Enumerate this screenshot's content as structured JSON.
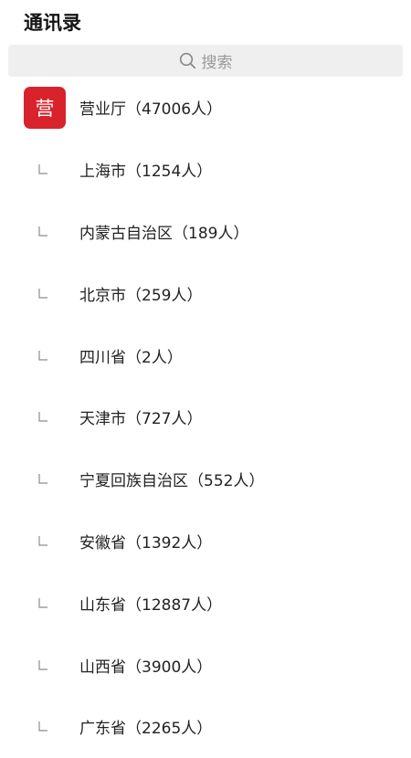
{
  "header": {
    "title": "通讯录"
  },
  "search": {
    "icon": "search-icon",
    "placeholder": "搜索"
  },
  "root": {
    "avatar_text": "营",
    "avatar_color": "#d9232c",
    "label": "营业厅（47006人）"
  },
  "children": [
    {
      "label": "上海市（1254人）"
    },
    {
      "label": "内蒙古自治区（189人）"
    },
    {
      "label": "北京市（259人）"
    },
    {
      "label": "四川省（2人）"
    },
    {
      "label": "天津市（727人）"
    },
    {
      "label": "宁夏回族自治区（552人）"
    },
    {
      "label": "安徽省（1392人）"
    },
    {
      "label": "山东省（12887人）"
    },
    {
      "label": "山西省（3900人）"
    },
    {
      "label": "广东省（2265人）"
    }
  ]
}
